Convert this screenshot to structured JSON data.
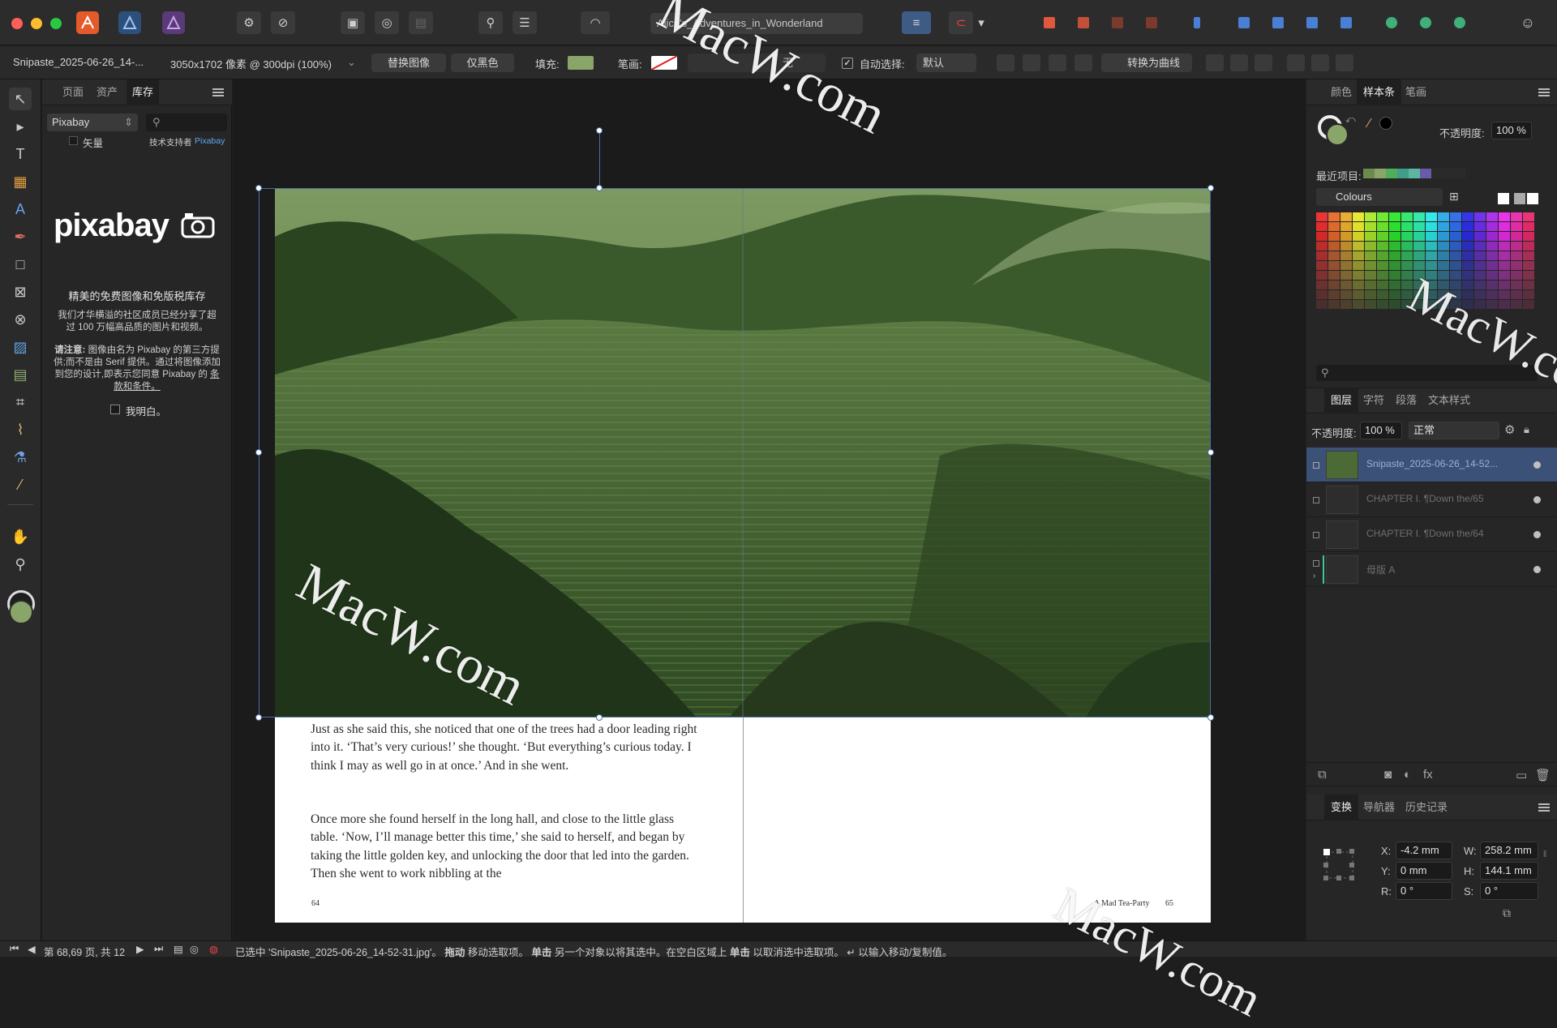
{
  "titlebar": {
    "doc_title": "Alice's_Adventures_in_Wonderland"
  },
  "context_bar": {
    "filename": "Snipaste_2025-06-26_14-...",
    "dimensions": "3050x1702 像素 @ 300dpi (100%)",
    "replace_image": "替换图像",
    "only_black": "仅黑色",
    "fill_label": "填充:",
    "stroke_label": "笔画:",
    "stroke_value": "无",
    "auto_select_label": "自动选择:",
    "auto_select_value": "默认",
    "convert_to_curves": "转换为曲线"
  },
  "left_panel": {
    "tabs": [
      "页面",
      "资产",
      "库存"
    ],
    "source_select": "Pixabay",
    "vector_label": "矢量",
    "powered_by": "技术支持者",
    "powered_by_link": "Pixabay",
    "logo": "pixabay",
    "headline": "精美的免费图像和免版税库存",
    "desc": "我们才华横溢的社区成员已经分享了超过 100 万幅高品质的图片和视频。",
    "note_label": "请注意:",
    "note_text": "图像由名为 Pixabay 的第三方提供;而不是由 Serif 提供。通过将图像添加到您的设计,即表示您同意 Pixabay 的",
    "terms_link": "条款和条件。",
    "agree_label": "我明白。"
  },
  "document": {
    "para1": "Just as she said this, she noticed that one of the trees had a door leading right into it. ‘That’s very curious!’ she thought. ‘But everything’s curious today. I think I may as well go in at once.’ And in she went.",
    "para2": "Once more she found herself in the long hall, and close to the little glass table. ‘Now, I’ll manage better this time,’ she said to herself, and began by taking the little golden key, and unlocking the door that led into the garden. Then she went to work nibbling at the",
    "left_page_number": "64",
    "right_running_head": "A Mad Tea-Party",
    "right_page_number": "65"
  },
  "right_panel": {
    "top_tabs": [
      "颜色",
      "样本条",
      "笔画"
    ],
    "opacity_label": "不透明度:",
    "opacity_value": "100 %",
    "recent_label": "最近项目:",
    "palette_name": "Colours",
    "layers_tabs": [
      "图层",
      "字符",
      "段落",
      "文本样式"
    ],
    "layers_opacity_label": "不透明度:",
    "layers_opacity_value": "100 %",
    "blend_mode": "正常",
    "layers": [
      {
        "name": "Snipaste_2025-06-26_14-52..."
      },
      {
        "name": "CHAPTER I. ¶Down the/65"
      },
      {
        "name": "CHAPTER I. ¶Down the/64"
      },
      {
        "name": "母版 A"
      }
    ],
    "transform_tabs": [
      "变换",
      "导航器",
      "历史记录"
    ],
    "x_label": "X:",
    "x_value": "-4.2 mm",
    "y_label": "Y:",
    "y_value": "0 mm",
    "w_label": "W:",
    "w_value": "258.2 mm",
    "h_label": "H:",
    "h_value": "144.1 mm",
    "r_label": "R:",
    "r_value": "0 °",
    "s_label": "S:",
    "s_value": "0 °"
  },
  "status": {
    "pages": "第 68,69 页, 共 12",
    "message_pre": "已选中 'Snipaste_2025-06-26_14-52-31.jpg'。",
    "drag_bold": "拖动",
    "drag_text": "移动选取项。",
    "click_bold": "单击",
    "click_text": "另一个对象以将其选中。在空白区域上",
    "click2_bold": "单击",
    "click2_text": "以取消选中选取项。",
    "enter_text": "以输入移动/复制值。"
  },
  "watermark": "MacW.com",
  "colors": {
    "photo_green": "#4b6a35",
    "selection": "#4a6fa5",
    "fill_swatch": "#8aa56a"
  }
}
